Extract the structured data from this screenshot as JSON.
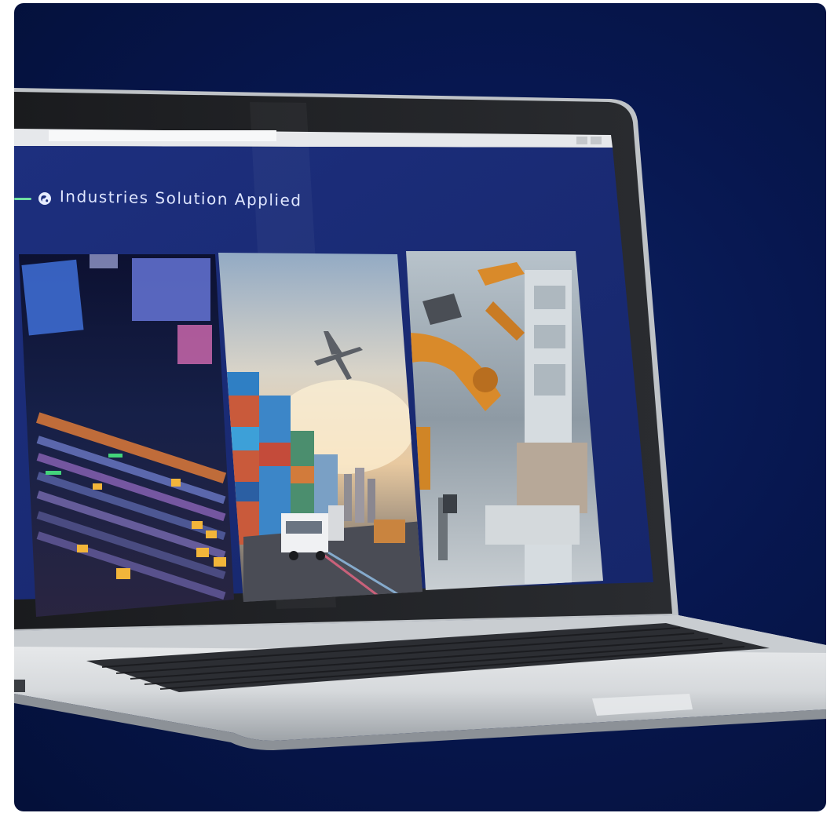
{
  "screen": {
    "heading": "Industries Solution Applied",
    "panels": [
      {
        "name": "broadcast-control-room",
        "caption": ""
      },
      {
        "name": "logistics-transport",
        "caption": ""
      },
      {
        "name": "robotic-manufacturing",
        "caption": ""
      }
    ]
  },
  "colors": {
    "background": "#061548",
    "screen": "#1b2d7a",
    "accent_line": "#6fe0a2",
    "laptop_silver": "#d9dcdf"
  },
  "icons": {
    "heading_icon": "globe-icon"
  }
}
